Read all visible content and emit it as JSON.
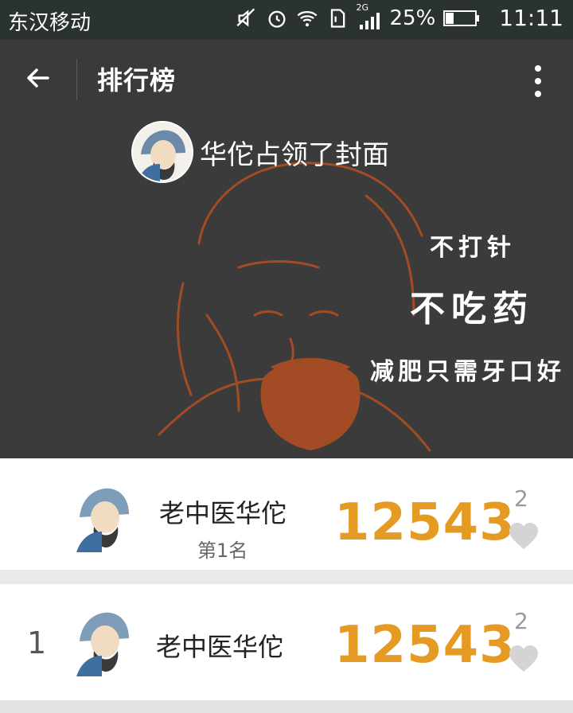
{
  "status_bar": {
    "carrier": "东汉移动",
    "network": "2G",
    "battery": "25%",
    "time": "11:11"
  },
  "appbar": {
    "title": "排行榜"
  },
  "cover": {
    "headline": "华佗占领了封面",
    "slogan_line1": "不打针",
    "slogan_line2": "不吃药",
    "slogan_line3": "减肥只需牙口好"
  },
  "ranking": [
    {
      "rank": "",
      "name": "老中医华佗",
      "subtitle": "第1名",
      "score": "12543",
      "likes": "2"
    },
    {
      "rank": "1",
      "name": "老中医华佗",
      "subtitle": "",
      "score": "12543",
      "likes": "2"
    }
  ],
  "colors": {
    "score": "#e59a23",
    "appbar": "#3a3a3a",
    "cover_bg": "#3b3b3b",
    "portrait": "#a24b25"
  },
  "icons": {
    "back": "back-arrow-icon",
    "more": "more-vertical-icon",
    "like": "heart-icon"
  }
}
